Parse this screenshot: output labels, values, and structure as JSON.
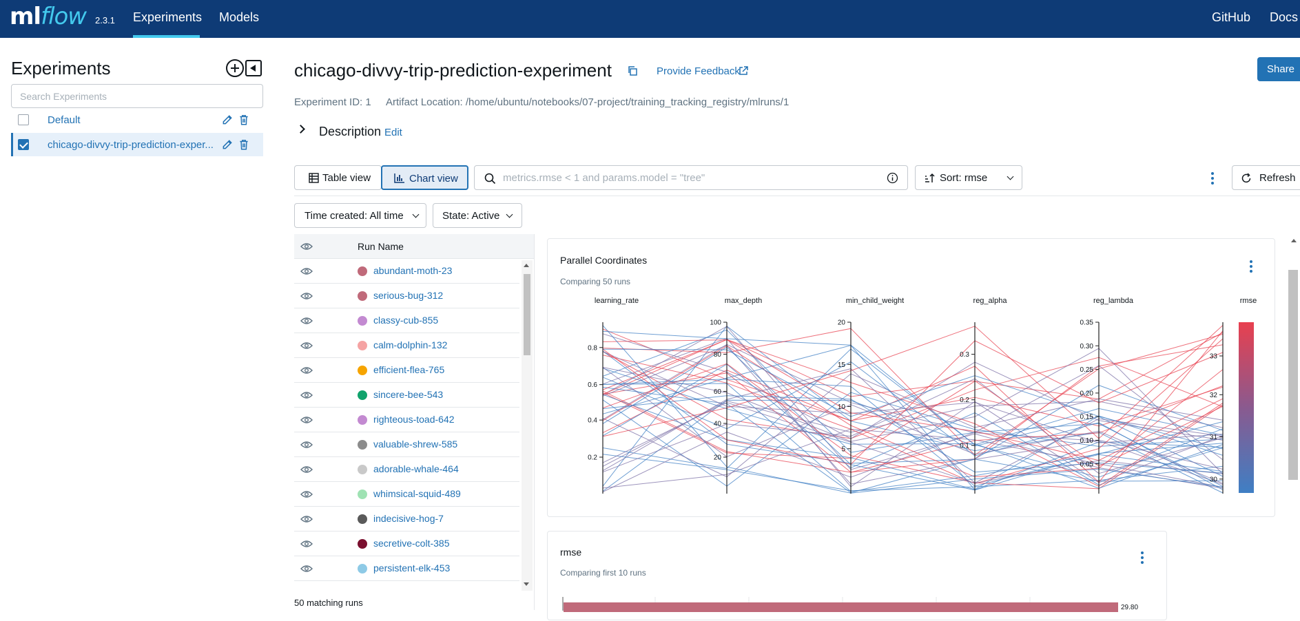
{
  "nav": {
    "logo_ml": "ml",
    "logo_flow": "flow",
    "version": "2.3.1",
    "links": [
      "Experiments",
      "Models"
    ],
    "right_links": [
      "GitHub",
      "Docs"
    ]
  },
  "sidebar": {
    "title": "Experiments",
    "search_placeholder": "Search Experiments",
    "experiments": [
      {
        "name": "Default",
        "checked": false
      },
      {
        "name": "chicago-divvy-trip-prediction-exper...",
        "checked": true
      }
    ]
  },
  "header": {
    "title": "chicago-divvy-trip-prediction-experiment",
    "feedback": "Provide Feedback",
    "share": "Share",
    "experiment_id": "Experiment ID: 1",
    "artifact_location": "Artifact Location: /home/ubuntu/notebooks/07-project/training_tracking_registry/mlruns/1",
    "description_label": "Description",
    "description_edit": "Edit"
  },
  "toolbar": {
    "table_view": "Table view",
    "chart_view": "Chart view",
    "filter_placeholder": "metrics.rmse < 1 and params.model = \"tree\"",
    "sort": "Sort: rmse",
    "refresh": "Refresh",
    "time_created": "Time created: All time",
    "state": "State: Active"
  },
  "runs": {
    "column": "Run Name",
    "rows": [
      {
        "name": "abundant-moth-23",
        "color": "#c06a7a"
      },
      {
        "name": "serious-bug-312",
        "color": "#c06a7a"
      },
      {
        "name": "classy-cub-855",
        "color": "#c38ad1"
      },
      {
        "name": "calm-dolphin-132",
        "color": "#f5a3a3"
      },
      {
        "name": "efficient-flea-765",
        "color": "#f6a400"
      },
      {
        "name": "sincere-bee-543",
        "color": "#11a36c"
      },
      {
        "name": "righteous-toad-642",
        "color": "#c38ad1"
      },
      {
        "name": "valuable-shrew-585",
        "color": "#8c8c8c"
      },
      {
        "name": "adorable-whale-464",
        "color": "#c9c9c9"
      },
      {
        "name": "whimsical-squid-489",
        "color": "#9fe2b3"
      },
      {
        "name": "indecisive-hog-7",
        "color": "#5a5a5a"
      },
      {
        "name": "secretive-colt-385",
        "color": "#7a0f2e"
      },
      {
        "name": "persistent-elk-453",
        "color": "#8ecae6"
      }
    ],
    "matching": "50 matching runs"
  },
  "parallel_card": {
    "title": "Parallel Coordinates",
    "subtitle": "Comparing 50 runs",
    "axes": [
      {
        "name": "learning_rate",
        "ticks": [
          "0.8",
          "0.6",
          "0.4",
          "0.2"
        ]
      },
      {
        "name": "max_depth",
        "ticks": [
          "100",
          "80",
          "60",
          "40",
          "20"
        ]
      },
      {
        "name": "min_child_weight",
        "ticks": [
          "20",
          "15",
          "10",
          "5"
        ]
      },
      {
        "name": "reg_alpha",
        "ticks": [
          "0.3",
          "0.2",
          "0.1"
        ]
      },
      {
        "name": "reg_lambda",
        "ticks": [
          "0.35",
          "0.30",
          "0.25",
          "0.20",
          "0.15",
          "0.10",
          "0.05"
        ]
      },
      {
        "name": "rmse",
        "ticks": [
          "33",
          "32",
          "31",
          "30"
        ]
      }
    ]
  },
  "rmse_card": {
    "title": "rmse",
    "subtitle": "Comparing first 10 runs",
    "first_value": "29.80"
  },
  "colors": {
    "nav_bg": "#0e3b76",
    "accent": "#2272b4",
    "nav_underline": "#43c9ed",
    "line_red": "#e8404f",
    "line_blue": "#3f7fc4"
  }
}
